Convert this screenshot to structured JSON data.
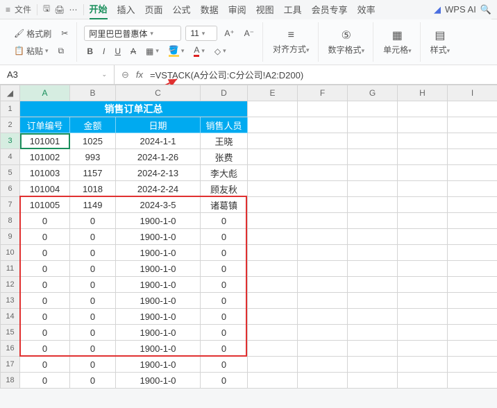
{
  "topbar": {
    "menu_label": "文件",
    "wps_ai": "WPS AI"
  },
  "tabs": {
    "items": [
      "开始",
      "插入",
      "页面",
      "公式",
      "数据",
      "审阅",
      "视图",
      "工具",
      "会员专享",
      "效率"
    ],
    "active_index": 0
  },
  "ribbon": {
    "format_brush": "格式刷",
    "paste": "粘贴",
    "font_family": "阿里巴巴普惠体",
    "font_size": "11",
    "align": "对齐方式",
    "number_format": "数字格式",
    "cell": "单元格",
    "style": "样式"
  },
  "namebox": {
    "value": "A3"
  },
  "formula": {
    "fx": "fx",
    "value": "=VSTACK(A分公司:C分公司!A2:D200)"
  },
  "columns": [
    "A",
    "B",
    "C",
    "D",
    "E",
    "F",
    "G",
    "H",
    "I"
  ],
  "title": "销售订单汇总",
  "headers": [
    "订单编号",
    "金额",
    "日期",
    "销售人员"
  ],
  "rows": [
    {
      "n": 3,
      "a": "101001",
      "b": "1025",
      "c": "2024-1-1",
      "d": "王晓"
    },
    {
      "n": 4,
      "a": "101002",
      "b": "993",
      "c": "2024-1-26",
      "d": "张费"
    },
    {
      "n": 5,
      "a": "101003",
      "b": "1157",
      "c": "2024-2-13",
      "d": "李大彪"
    },
    {
      "n": 6,
      "a": "101004",
      "b": "1018",
      "c": "2024-2-24",
      "d": "顾友秋"
    },
    {
      "n": 7,
      "a": "101005",
      "b": "1149",
      "c": "2024-3-5",
      "d": "诸葛镇"
    },
    {
      "n": 8,
      "a": "0",
      "b": "0",
      "c": "1900-1-0",
      "d": "0"
    },
    {
      "n": 9,
      "a": "0",
      "b": "0",
      "c": "1900-1-0",
      "d": "0"
    },
    {
      "n": 10,
      "a": "0",
      "b": "0",
      "c": "1900-1-0",
      "d": "0"
    },
    {
      "n": 11,
      "a": "0",
      "b": "0",
      "c": "1900-1-0",
      "d": "0"
    },
    {
      "n": 12,
      "a": "0",
      "b": "0",
      "c": "1900-1-0",
      "d": "0"
    },
    {
      "n": 13,
      "a": "0",
      "b": "0",
      "c": "1900-1-0",
      "d": "0"
    },
    {
      "n": 14,
      "a": "0",
      "b": "0",
      "c": "1900-1-0",
      "d": "0"
    },
    {
      "n": 15,
      "a": "0",
      "b": "0",
      "c": "1900-1-0",
      "d": "0"
    },
    {
      "n": 16,
      "a": "0",
      "b": "0",
      "c": "1900-1-0",
      "d": "0"
    },
    {
      "n": 17,
      "a": "0",
      "b": "0",
      "c": "1900-1-0",
      "d": "0"
    },
    {
      "n": 18,
      "a": "0",
      "b": "0",
      "c": "1900-1-0",
      "d": "0"
    }
  ]
}
